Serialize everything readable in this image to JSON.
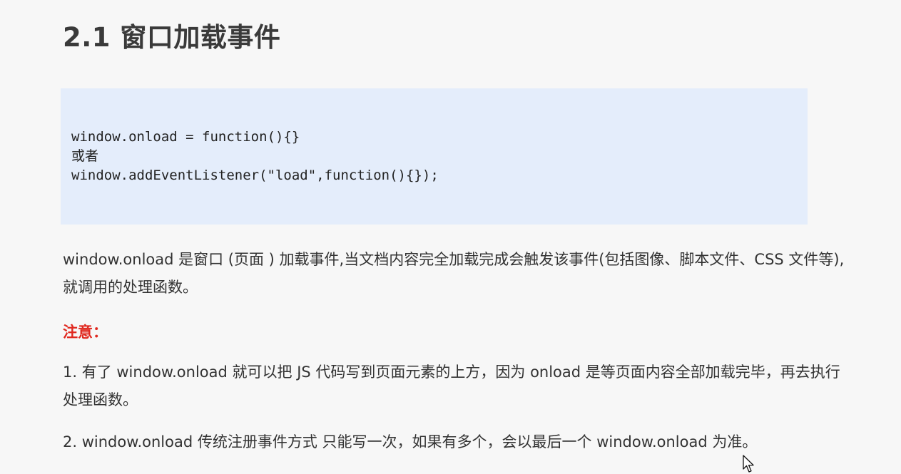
{
  "section": {
    "title": "2.1 窗口加载事件"
  },
  "code": {
    "lines": [
      "window.onload = function(){}",
      "或者",
      "window.addEventListener(\"load\",function(){});"
    ]
  },
  "description": "window.onload 是窗口 (页面 ) 加载事件,当文档内容完全加载完成会触发该事件(包括图像、脚本文件、CSS 文件等), 就调用的处理函数。",
  "note": {
    "label": "注意：",
    "items": [
      "1. 有了 window.onload 就可以把 JS 代码写到页面元素的上方，因为 onload 是等页面内容全部加载完毕，再去执行处理函数。",
      "2. window.onload 传统注册事件方式 只能写一次，如果有多个，会以最后一个 window.onload 为准。"
    ]
  },
  "colors": {
    "code_background": "#e4edfb",
    "note_label": "#e0281f",
    "page_background": "#f7f7f7"
  },
  "icons": {
    "cursor": "mouse-pointer-icon"
  }
}
